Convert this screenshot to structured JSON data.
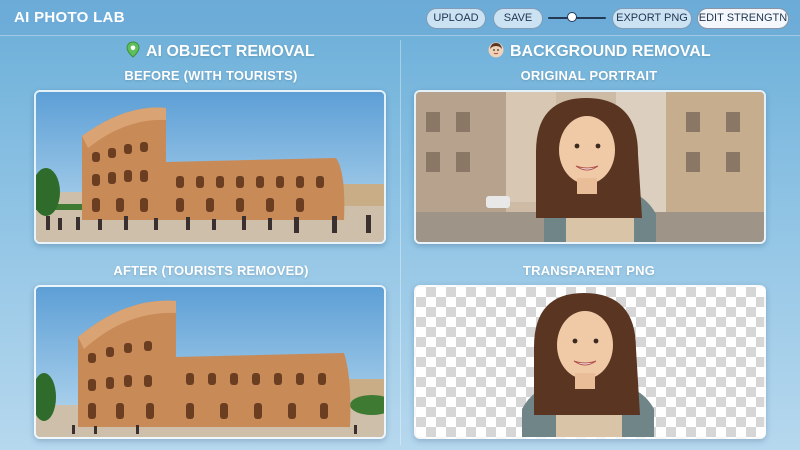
{
  "app": {
    "title": "AI PHOTO LAB"
  },
  "toolbar": {
    "upload_label": "UPLOAD",
    "save_label": "SAVE",
    "strength_value": 0.4,
    "export_label": "EXPORT PNG",
    "edit_strength_label": "EDIT STRENGTN"
  },
  "object_removal": {
    "title": "AI OBJECT REMOVAL",
    "icon": "map-pin-icon",
    "before_caption": "BEFORE (WITH TOURISTS)",
    "after_caption": "AFTER (TOURISTS REMOVED)"
  },
  "background_removal": {
    "title": "BACKGROUND REMOVAL",
    "icon": "person-avatar-icon",
    "original_caption": "ORIGINAL PORTRAIT",
    "transparent_caption": "TRANSPARENT PNG"
  },
  "colors": {
    "accent_green": "#5fbf5a",
    "background_blue": "#8ec3e4",
    "button_text": "#1f3550"
  }
}
